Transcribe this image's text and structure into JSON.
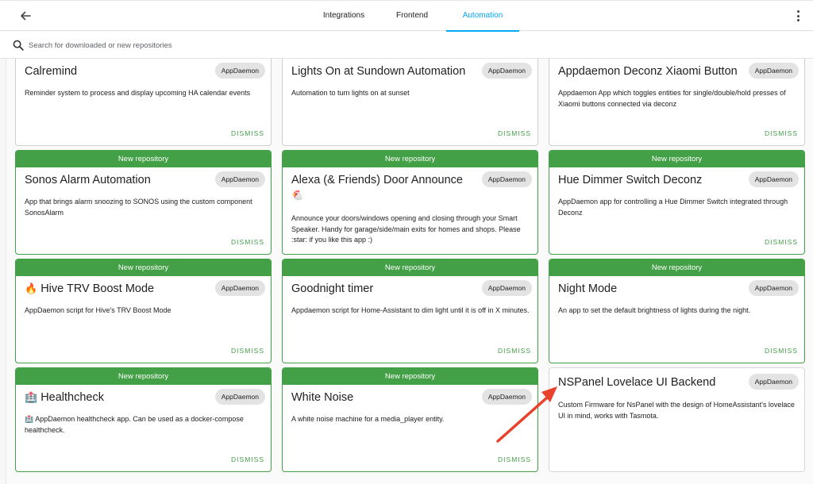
{
  "header": {
    "back_icon": "arrow-left-icon",
    "tabs": [
      {
        "label": "Integrations"
      },
      {
        "label": "Frontend"
      },
      {
        "label": "Automation"
      }
    ],
    "active_tab": "Automation",
    "menu_icon": "dots-vertical-icon"
  },
  "search": {
    "placeholder": "Search for downloaded or new repositories",
    "value": ""
  },
  "banner_label": "New repository",
  "dismiss_label": "DISMISS",
  "cards": [
    {
      "title": "Calremind",
      "chip": "AppDaemon",
      "desc": "Reminder system to process and display upcoming HA calendar events"
    },
    {
      "title": "Lights On at Sundown Automation",
      "chip": "AppDaemon",
      "desc": "Automation to turn lights on at sunset"
    },
    {
      "title": "Appdaemon Deconz Xiaomi Button",
      "chip": "AppDaemon",
      "desc": "Appdaemon App which toggles entities for single/double/hold presses of Xiaomi buttons connected via deconz"
    },
    {
      "title": "Sonos Alarm Automation",
      "chip": "AppDaemon",
      "desc": "App that brings alarm snoozing to SONOS using the custom component SonosAlarm"
    },
    {
      "title": "Alexa (& Friends) Door Announce",
      "emoji_line": "🐔",
      "chip": "AppDaemon",
      "desc": "Announce your doors/windows opening and closing through your Smart Speaker. Handy for garage/side/main exits for homes and shops. Please :star: if you like this app :)"
    },
    {
      "title": "Hue Dimmer Switch Deconz",
      "chip": "AppDaemon",
      "desc": "AppDaemon app for controlling a Hue Dimmer Switch integrated through Deconz"
    },
    {
      "title": "Hive TRV Boost Mode",
      "emoji": "🔥",
      "chip": "AppDaemon",
      "desc": "AppDaemon script for Hive's TRV Boost Mode"
    },
    {
      "title": "Goodnight timer",
      "chip": "AppDaemon",
      "desc": "Appdaemon script for Home-Assistant to dim light until it is off in X minutes."
    },
    {
      "title": "Night Mode",
      "chip": "AppDaemon",
      "desc": "An app to set the default brightness of lights during the night."
    },
    {
      "title": "Healthcheck",
      "emoji": "🏥",
      "chip": "AppDaemon",
      "desc": "🏥 AppDaemon healthcheck app. Can be used as a docker-compose healthcheck."
    },
    {
      "title": "White Noise",
      "chip": "AppDaemon",
      "desc": "A white noise machine for a media_player entity."
    },
    {
      "title": "NSPanel Lovelace UI Backend",
      "chip": "AppDaemon",
      "desc": "Custom Firmware for NsPanel with the design of HomeAssistant's lovelace UI in mind, works with Tasmota."
    }
  ],
  "colors": {
    "accent": "#03a9f4",
    "new_banner": "#43a047",
    "dismiss": "#43a047",
    "annotation_arrow": "#e8412c"
  }
}
